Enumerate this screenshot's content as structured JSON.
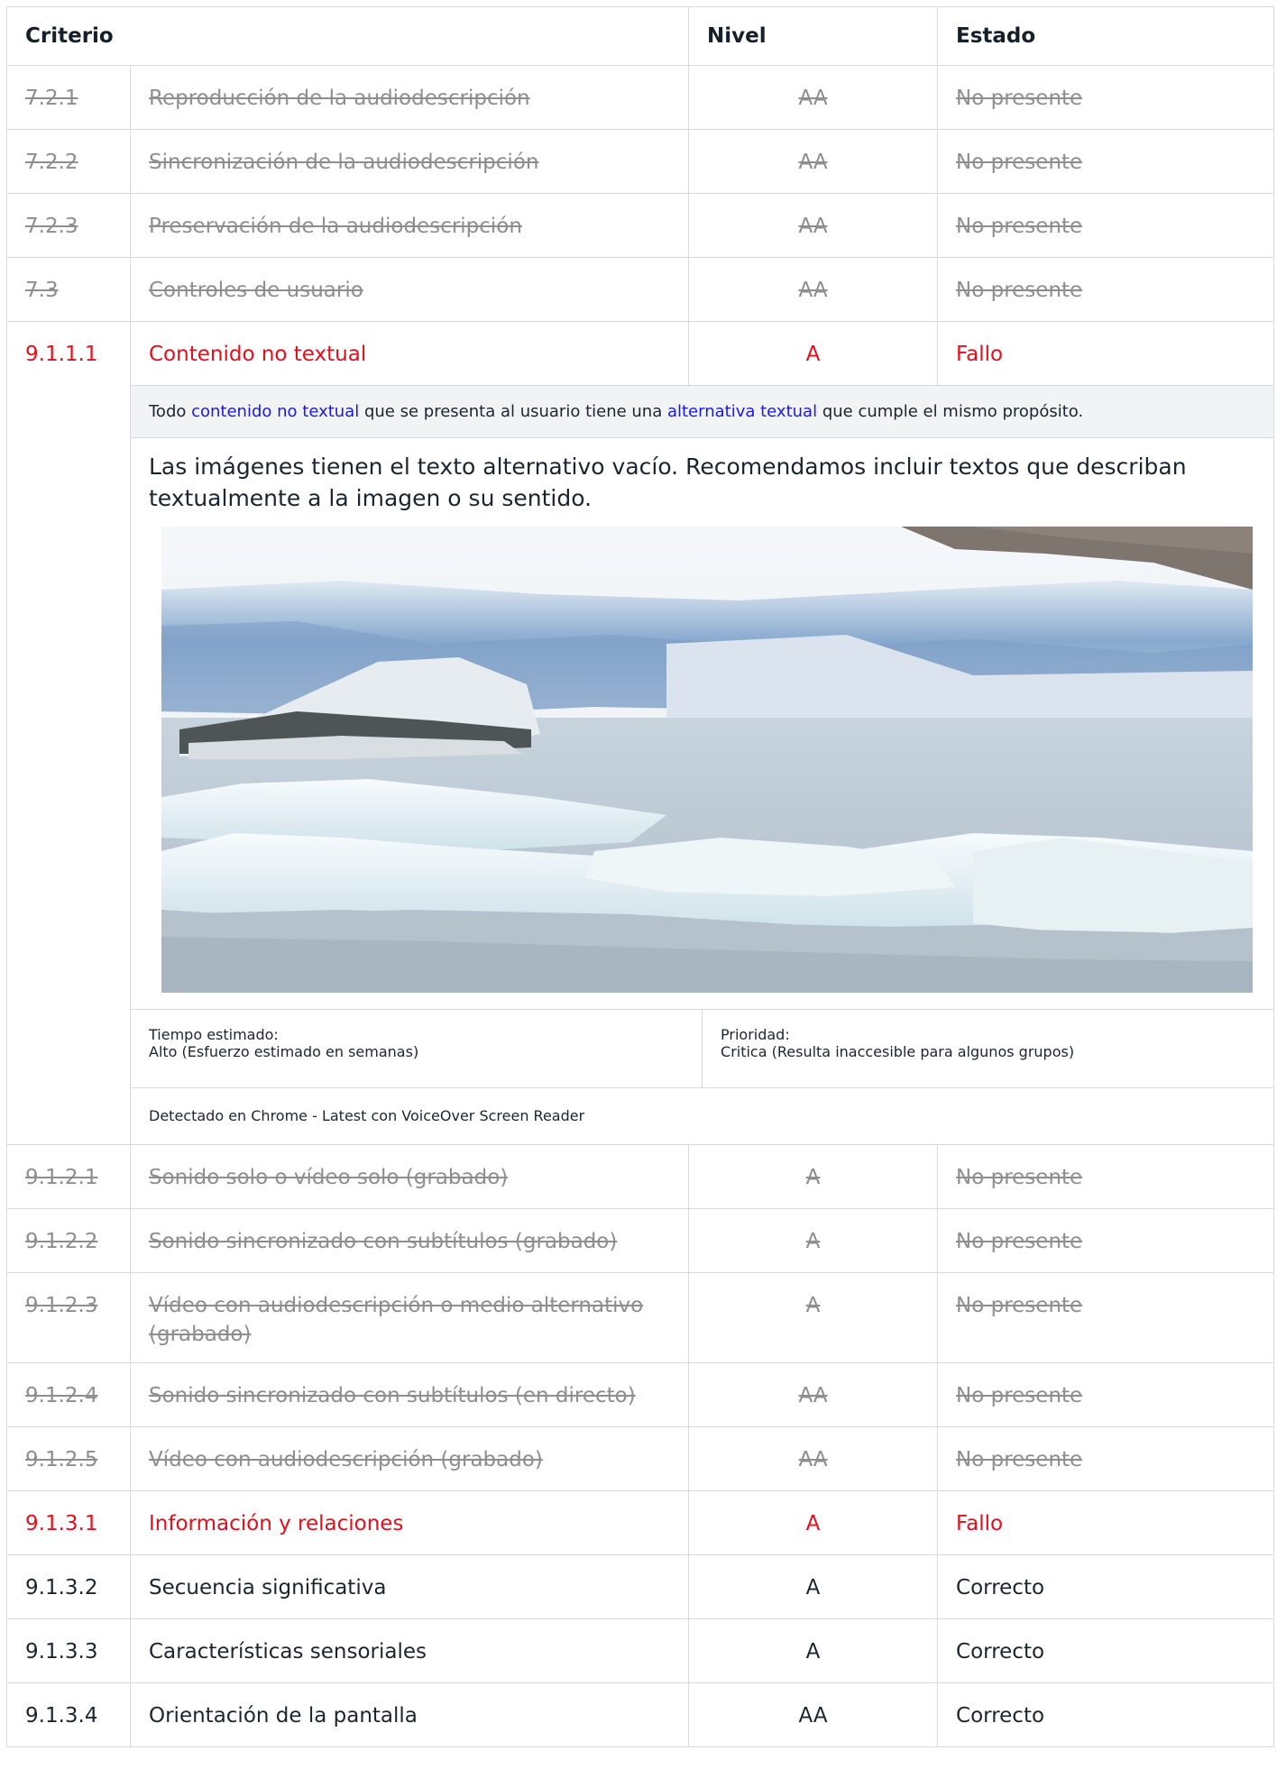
{
  "header": {
    "criterion": "Criterio",
    "level": "Nivel",
    "status": "Estado"
  },
  "rows_top": [
    {
      "id": "7.2.1",
      "name": "Reproducción de la audiodescripción",
      "level": "AA",
      "status": "No presente"
    },
    {
      "id": "7.2.2",
      "name": "Sincronización de la audiodescripción",
      "level": "AA",
      "status": "No presente"
    },
    {
      "id": "7.2.3",
      "name": "Preservación de la audiodescripción",
      "level": "AA",
      "status": "No presente"
    },
    {
      "id": "7.3",
      "name": "Controles de usuario",
      "level": "AA",
      "status": "No presente"
    }
  ],
  "expanded": {
    "id": "9.1.1.1",
    "name": "Contenido no textual",
    "level": "A",
    "status": "Fallo",
    "desc_prefix": "Todo ",
    "desc_link1": "contenido no textual",
    "desc_mid": " que se presenta al usuario tiene una ",
    "desc_link2": "alternativa textual",
    "desc_suffix": " que cumple el mismo propósito.",
    "comment": "Las imágenes tienen el texto alternativo vacío. Recomendamos incluir textos que describan textualmente a la imagen o su sentido.",
    "time_label": "Tiempo estimado:",
    "time_value": "Alto (Esfuerzo estimado en semanas)",
    "priority_label": "Prioridad:",
    "priority_value": "Critica (Resulta inaccesible para algunos grupos)",
    "detected": "Detectado en Chrome - Latest con VoiceOver Screen Reader"
  },
  "rows_bottom": [
    {
      "id": "9.1.2.1",
      "name": "Sonido solo o vídeo solo (grabado)",
      "level": "A",
      "status": "No presente",
      "state": "na"
    },
    {
      "id": "9.1.2.2",
      "name": "Sonido sincronizado con subtítulos (grabado)",
      "level": "A",
      "status": "No presente",
      "state": "na"
    },
    {
      "id": "9.1.2.3",
      "name": "Vídeo con audiodescripción o medio alternativo (grabado)",
      "level": "A",
      "status": "No presente",
      "state": "na"
    },
    {
      "id": "9.1.2.4",
      "name": "Sonido sincronizado con subtítulos (en directo)",
      "level": "AA",
      "status": "No presente",
      "state": "na"
    },
    {
      "id": "9.1.2.5",
      "name": "Vídeo con audiodescripción (grabado)",
      "level": "AA",
      "status": "No presente",
      "state": "na"
    },
    {
      "id": "9.1.3.1",
      "name": "Información y relaciones",
      "level": "A",
      "status": "Fallo",
      "state": "fail"
    },
    {
      "id": "9.1.3.2",
      "name": "Secuencia significativa",
      "level": "A",
      "status": "Correcto",
      "state": "ok"
    },
    {
      "id": "9.1.3.3",
      "name": "Características sensoriales",
      "level": "A",
      "status": "Correcto",
      "state": "ok"
    },
    {
      "id": "9.1.3.4",
      "name": "Orientación de la pantalla",
      "level": "AA",
      "status": "Correcto",
      "state": "ok"
    }
  ]
}
